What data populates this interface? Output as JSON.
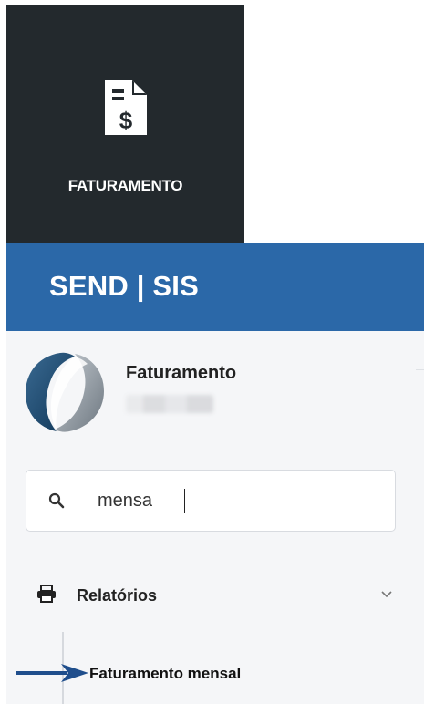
{
  "tile": {
    "label": "FATURAMENTO",
    "icon": "invoice-dollar-icon"
  },
  "header": {
    "brand": "SEND | SIS"
  },
  "profile": {
    "name": "Faturamento",
    "icon": "company-logo"
  },
  "search": {
    "value": "mensa",
    "icon": "search-icon"
  },
  "menu": {
    "group_label": "Relatórios",
    "group_icon": "printer-icon",
    "expand_icon": "chevron-down-icon",
    "items": [
      {
        "label": "Faturamento mensal"
      }
    ]
  },
  "annotation": {
    "icon": "arrow-right-icon"
  },
  "colors": {
    "tile_bg": "#23292d",
    "header_bg": "#2b68a8",
    "panel_bg": "#f5f6f8",
    "arrow": "#1f4e8c"
  }
}
